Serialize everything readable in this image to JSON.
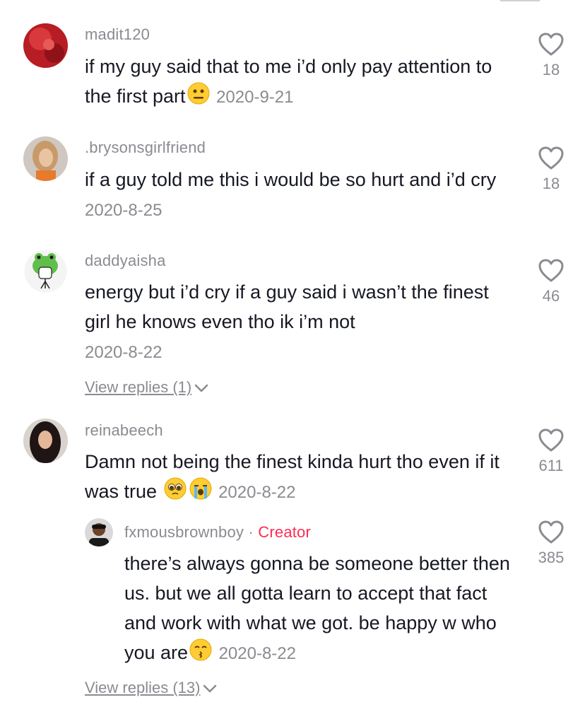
{
  "comments": [
    {
      "username": "madit120",
      "text": "if my guy said that to me i’d only pay attention to the first part",
      "date": "2020-9-21",
      "likes": "18",
      "avatar_color": "#c0232b"
    },
    {
      "username": ".brysonsgirlfriend",
      "text": "if a guy told me this i would be so hurt and i’d cry",
      "date": "2020-8-25",
      "likes": "18",
      "avatar_color": "#b98a62"
    },
    {
      "username": "daddyaisha",
      "text": "energy but i’d cry if a guy said i wasn’t the finest girl he knows even tho ik i’m not",
      "date": "2020-8-22",
      "likes": "46",
      "avatar_color": "#5fbf4a",
      "view_replies": "View replies (1)"
    },
    {
      "username": "reinabeech",
      "text": "Damn not being the finest kinda hurt tho even if it was true",
      "date": "2020-8-22",
      "likes": "611",
      "avatar_color": "#2b1e1c"
    }
  ],
  "reply": {
    "username": "fxmousbrownboy",
    "separator": "·",
    "badge": "Creator",
    "text": "there’s always gonna be someone better then us. but we all gotta learn to accept that fact and work with what we got. be happy w who you are",
    "date": "2020-8-22",
    "likes": "385",
    "avatar_color": "#1a1a1a"
  },
  "bottom_view_replies": "View replies (13)",
  "colors": {
    "secondary_text": "#8a8b91",
    "creator_badge": "#fe2c55",
    "primary_text": "#161823"
  },
  "icons": [
    "heart-outline-icon",
    "chevron-down-icon"
  ]
}
